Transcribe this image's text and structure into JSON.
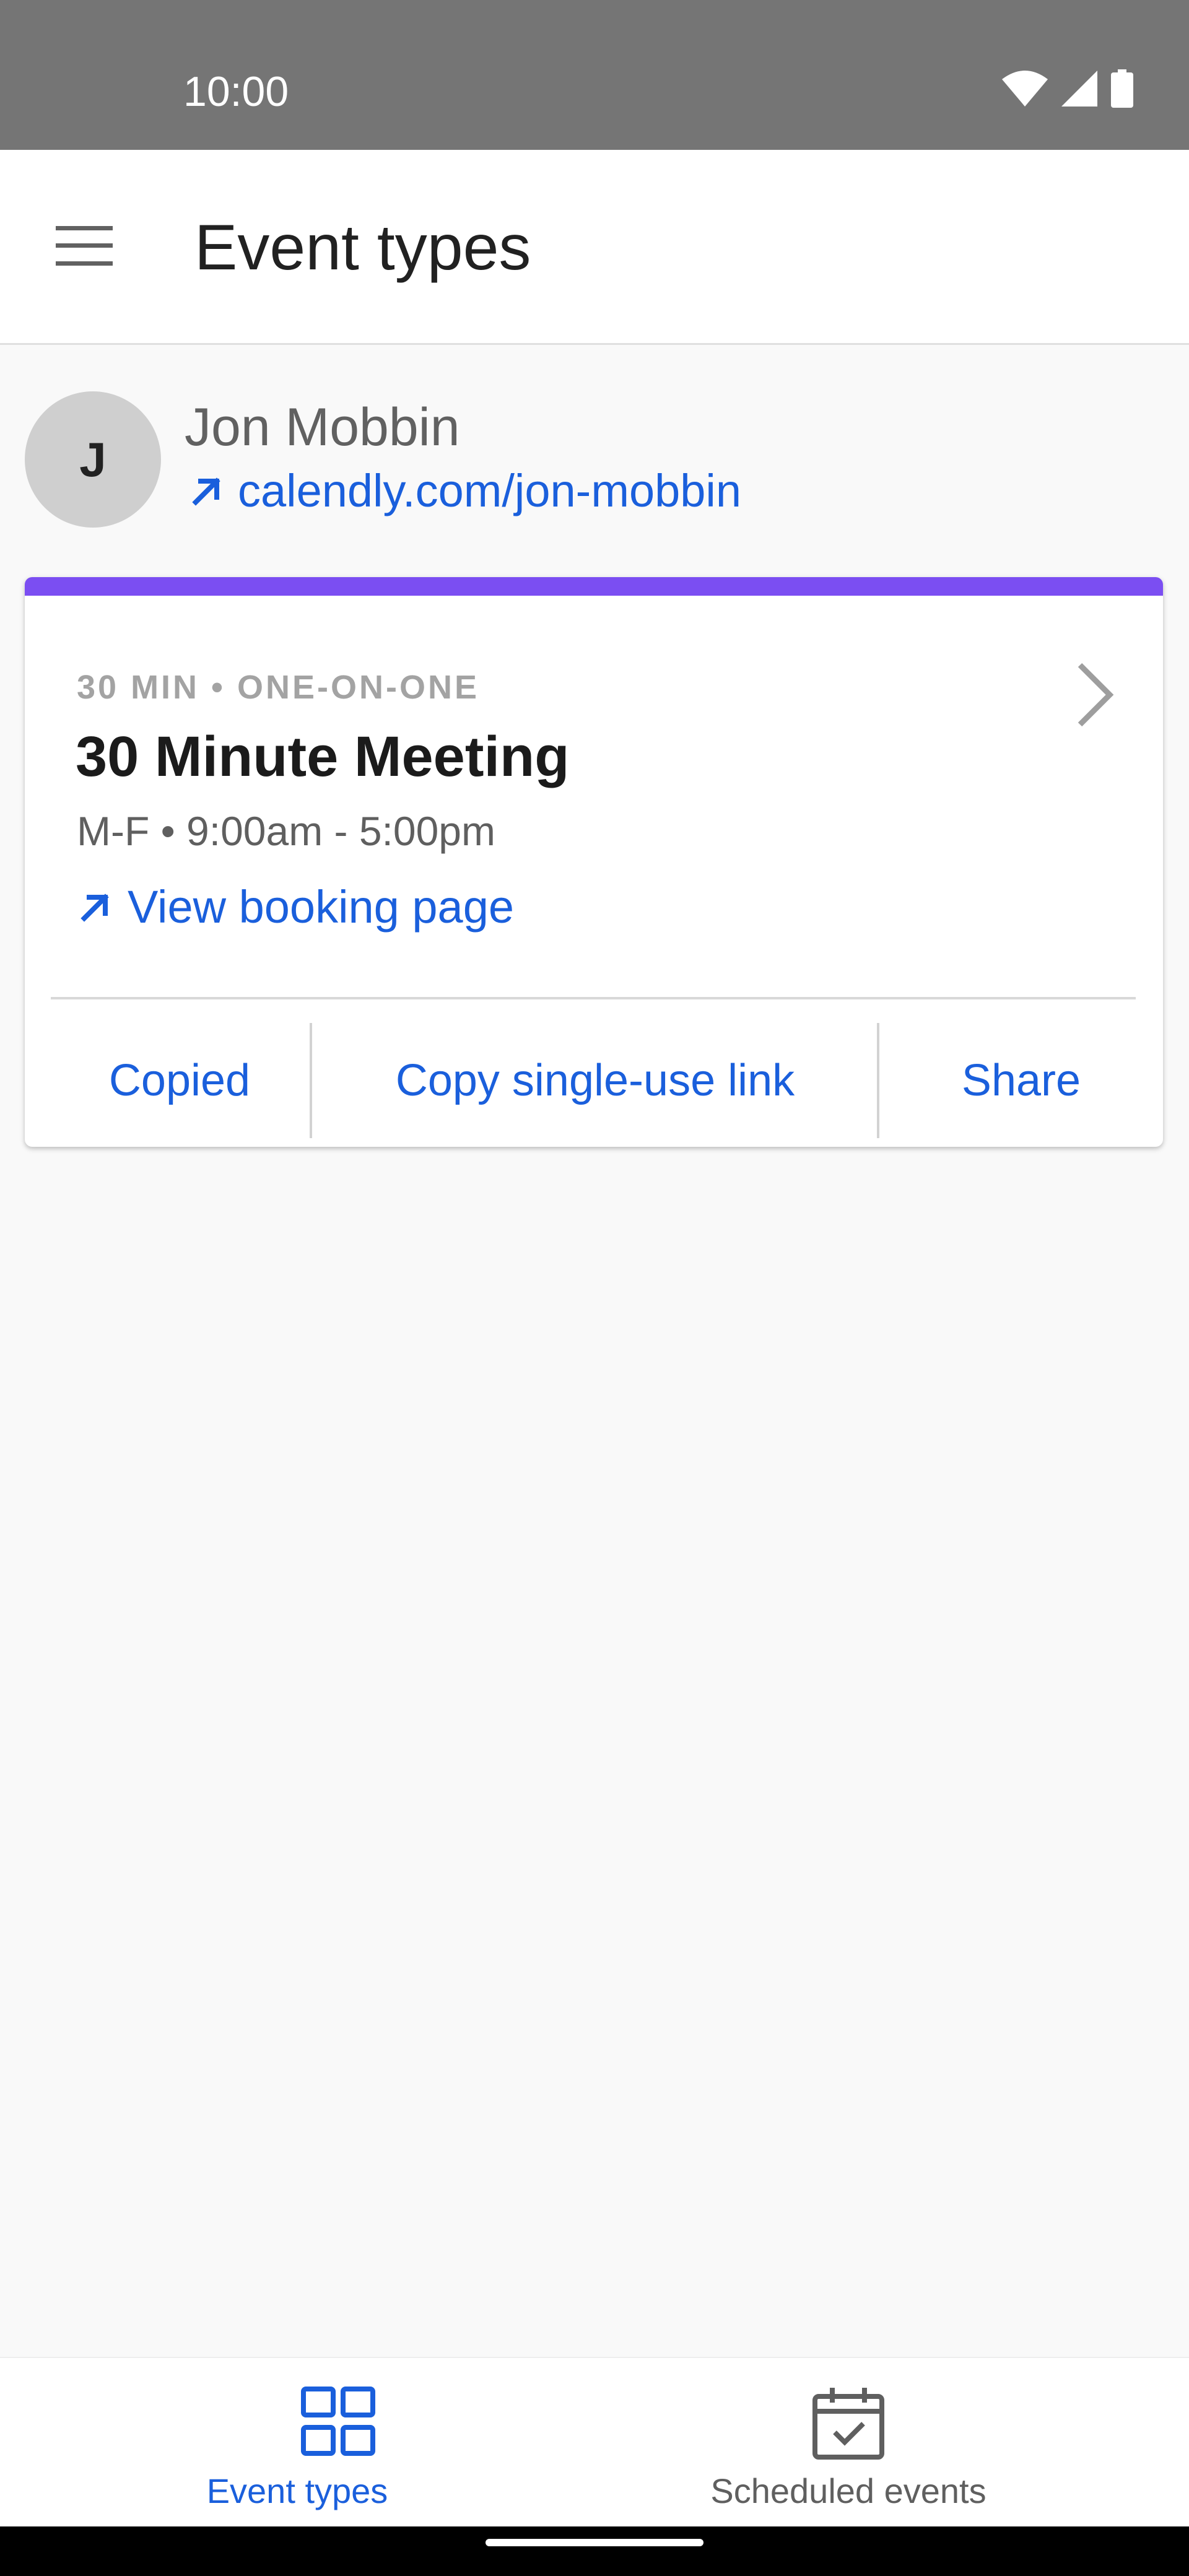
{
  "status_bar": {
    "time": "10:00",
    "icons": [
      "wifi-icon",
      "signal-icon",
      "battery-icon"
    ]
  },
  "app_bar": {
    "menu_icon": "hamburger-menu-icon",
    "title": "Event types"
  },
  "profile": {
    "initial": "J",
    "name": "Jon Mobbin",
    "link": "calendly.com/jon-mobbin",
    "link_icon": "arrow-up-right-icon"
  },
  "event_card": {
    "accent_color": "#7b4ef2",
    "meta": "30 MIN • ONE-ON-ONE",
    "title": "30 Minute Meeting",
    "schedule": "M-F • 9:00am - 5:00pm",
    "booking_link": "View booking page",
    "chevron_icon": "chevron-right-icon",
    "actions": {
      "copied": "Copied",
      "copy_single_use": "Copy single-use link",
      "share": "Share"
    }
  },
  "bottom_nav": {
    "items": [
      {
        "label": "Event types",
        "icon": "grid-icon",
        "active": true
      },
      {
        "label": "Scheduled events",
        "icon": "calendar-check-icon",
        "active": false
      }
    ]
  },
  "colors": {
    "link": "#1a5fdc",
    "status_bar": "#757575",
    "active_nav": "#1a5fdc",
    "inactive_nav": "#5f5f5f"
  }
}
